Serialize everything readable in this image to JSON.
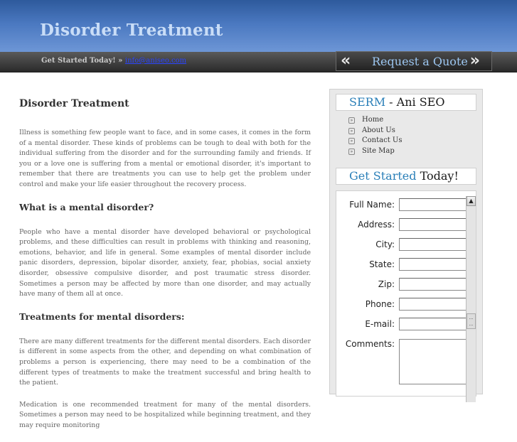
{
  "header": {
    "site_title": "Disorder Treatment",
    "tagline": "Get Started Today! » ",
    "email_link": "info@aniseo.com",
    "quote_button": {
      "label": "Request a Quote",
      "left_chevron": "«",
      "right_chevron": "»"
    }
  },
  "main": {
    "title": "Disorder Treatment",
    "intro": "Illness is something few people want to face, and in some cases, it comes in the form of a mental disorder. These kinds of problems can be tough to deal with both for the individual suffering from the disorder and for the surrounding family and friends. If you or a love one is suffering from a mental or emotional disorder, it's important to remember that there are treatments you can use to help get the problem under control and make your life easier throughout the recovery process.",
    "section1_heading": "What is a mental disorder?",
    "section1_text": "People who have a mental disorder have developed behavioral or psychological problems, and these difficulties can result in problems with thinking and reasoning, emotions, behavior, and life in general. Some examples of mental disorder include panic disorders, depression, bipolar disorder, anxiety, fear, phobias, social anxiety disorder, obsessive compulsive disorder, and post traumatic stress disorder. Sometimes a person may be affected by more than one disorder, and may actually have many of them all at once.",
    "section2_heading": "Treatments for mental disorders:",
    "section2_text": "There are many different treatments for the different mental disorders. Each disorder is different in some aspects from the other, and depending on what combination of problems a person is experiencing, there may need to be a combination of the different types of treatments to make the treatment successful and bring health to the patient.",
    "section3_text": "Medication is one recommended treatment for many of the mental disorders. Sometimes a person may need to be hospitalized while beginning treatment, and they may require monitoring"
  },
  "sidebar": {
    "brand_box": {
      "highlight": "SERM",
      "rest": " - Ani SEO"
    },
    "nav": [
      {
        "label": "Home"
      },
      {
        "label": "About Us"
      },
      {
        "label": "Contact Us"
      },
      {
        "label": "Site Map"
      }
    ],
    "bullet_icon": "»",
    "get_started_box": {
      "highlight": "Get Started",
      "rest": " Today!"
    },
    "form": {
      "fields": [
        {
          "label": "Full Name:",
          "value": ""
        },
        {
          "label": "Address:",
          "value": ""
        },
        {
          "label": "City:",
          "value": ""
        },
        {
          "label": "State:",
          "value": ""
        },
        {
          "label": "Zip:",
          "value": ""
        },
        {
          "label": "Phone:",
          "value": ""
        },
        {
          "label": "E-mail:",
          "value": ""
        }
      ],
      "comments_label": "Comments:",
      "comments_value": ""
    },
    "scroll_up_icon": "▲"
  },
  "colors": {
    "header_top": "#2e5a9c",
    "header_bottom": "#6d96d6",
    "title_text": "#c9ddf7",
    "link": "#2a44ff",
    "accent": "#2a7fb8",
    "quote_label": "#9cc6f0"
  }
}
